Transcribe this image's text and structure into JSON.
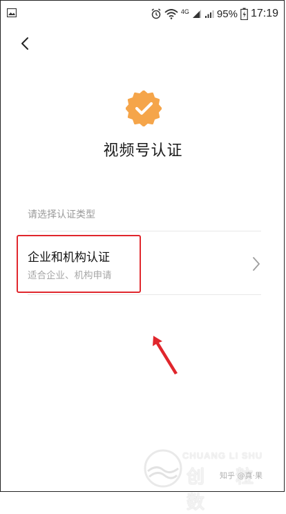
{
  "status_bar": {
    "signal_label": "4G",
    "battery": "95%",
    "time": "17:19"
  },
  "page": {
    "title": "视频号认证",
    "section_label": "请选择认证类型",
    "options": [
      {
        "title": "企业和机构认证",
        "subtitle": "适合企业、机构申请"
      }
    ]
  },
  "icons": {
    "back": "chevron-left-icon",
    "badge": "verified-badge-icon",
    "row_arrow": "chevron-right-icon"
  },
  "colors": {
    "badge": "#f5a54a",
    "highlight": "#e0262c",
    "arrow": "#e0262c",
    "label": "#9a9a9a",
    "subtitle": "#a6a6a6"
  },
  "watermark": {
    "english": "CHUANG LI SHU",
    "chinese": "创 粒 数",
    "handle": "知乎 @真·果"
  }
}
